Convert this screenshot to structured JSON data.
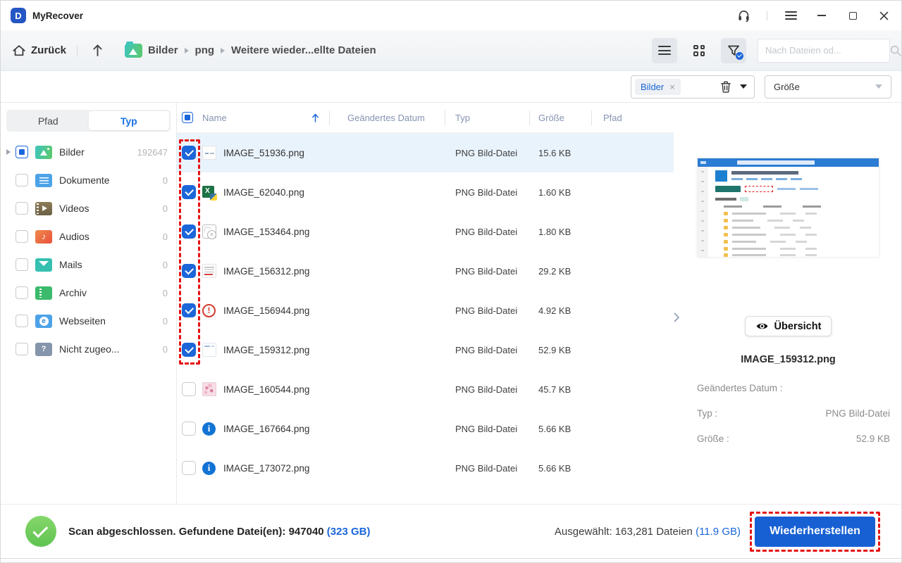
{
  "window": {
    "title": "MyRecover",
    "icons": [
      "headset-icon",
      "menu-icon",
      "minimize-icon",
      "maximize-icon",
      "close-icon"
    ]
  },
  "navbar": {
    "back_label": "Zurück",
    "breadcrumb": [
      "Bilder",
      "png",
      "Weitere wieder...ellte Dateien"
    ],
    "view_icons": [
      "list-view-icon",
      "grid-view-icon",
      "filter-funnel-icon"
    ],
    "search_placeholder": "Nach Dateien od..."
  },
  "filterbar": {
    "type_chip": "Bilder",
    "chip_close_glyph": "×",
    "icons": [
      "trash-icon",
      "caret-down-icon"
    ],
    "size_dropdown_value": "Größe"
  },
  "sidebar": {
    "tabs": [
      {
        "label": "Pfad",
        "active": false
      },
      {
        "label": "Typ",
        "active": true
      }
    ],
    "items": [
      {
        "label": "Bilder",
        "count": "192647",
        "checked": "indeterminate",
        "expandable": true,
        "icon": "images-folder"
      },
      {
        "label": "Dokumente",
        "count": "0",
        "checked": "none",
        "expandable": false,
        "icon": "documents"
      },
      {
        "label": "Videos",
        "count": "0",
        "checked": "none",
        "expandable": false,
        "icon": "videos"
      },
      {
        "label": "Audios",
        "count": "0",
        "checked": "none",
        "expandable": false,
        "icon": "audios"
      },
      {
        "label": "Mails",
        "count": "0",
        "checked": "none",
        "expandable": false,
        "icon": "mails"
      },
      {
        "label": "Archiv",
        "count": "0",
        "checked": "none",
        "expandable": false,
        "icon": "archive"
      },
      {
        "label": "Webseiten",
        "count": "0",
        "checked": "none",
        "expandable": false,
        "icon": "web"
      },
      {
        "label": "Nicht zugeo...",
        "count": "0",
        "checked": "none",
        "expandable": false,
        "icon": "unknown"
      }
    ]
  },
  "table": {
    "columns": [
      "Name",
      "Geändertes Datum",
      "Typ",
      "Größe",
      "Pfad"
    ],
    "sort_icon": "sort-ascending-icon",
    "rows": [
      {
        "name": "IMAGE_51936.png",
        "type": "PNG Bild-Datei",
        "size": "15.6 KB",
        "checked": true,
        "selected": true,
        "icon": "thumb-sketch"
      },
      {
        "name": "IMAGE_62040.png",
        "type": "PNG Bild-Datei",
        "size": "1.60 KB",
        "checked": true,
        "selected": false,
        "icon": "excel-python"
      },
      {
        "name": "IMAGE_153464.png",
        "type": "PNG Bild-Datei",
        "size": "1.80 KB",
        "checked": true,
        "selected": false,
        "icon": "broken-image"
      },
      {
        "name": "IMAGE_156312.png",
        "type": "PNG Bild-Datei",
        "size": "29.2 KB",
        "checked": true,
        "selected": false,
        "icon": "thumb-text"
      },
      {
        "name": "IMAGE_156944.png",
        "type": "PNG Bild-Datei",
        "size": "4.92 KB",
        "checked": true,
        "selected": false,
        "icon": "error"
      },
      {
        "name": "IMAGE_159312.png",
        "type": "PNG Bild-Datei",
        "size": "52.9 KB",
        "checked": true,
        "selected": false,
        "icon": "thumb-faint"
      },
      {
        "name": "IMAGE_160544.png",
        "type": "PNG Bild-Datei",
        "size": "45.7 KB",
        "checked": false,
        "selected": false,
        "icon": "thumb-flower"
      },
      {
        "name": "IMAGE_167664.png",
        "type": "PNG Bild-Datei",
        "size": "5.66 KB",
        "checked": false,
        "selected": false,
        "icon": "info"
      },
      {
        "name": "IMAGE_173072.png",
        "type": "PNG Bild-Datei",
        "size": "5.66 KB",
        "checked": false,
        "selected": false,
        "icon": "info"
      }
    ]
  },
  "preview": {
    "overview_button": "Übersicht",
    "overview_icon": "eye-icon",
    "filename": "IMAGE_159312.png",
    "fields": [
      {
        "label": "Geändertes Datum :",
        "value": ""
      },
      {
        "label": "Typ :",
        "value": "PNG Bild-Datei"
      },
      {
        "label": "Größe :",
        "value": "52.9 KB"
      }
    ]
  },
  "statusbar": {
    "scan_text": "Scan abgeschlossen. Gefundene Datei(en): 947040 ",
    "scan_size": "(323 GB)",
    "selected_text": "Ausgewählt: 163,281 Dateien ",
    "selected_size": "(11.9 GB)",
    "recover_button": "Wiederherstellen"
  },
  "colors": {
    "accent_blue": "#1b66d9",
    "link_blue": "#1a73e8",
    "selected_row": "#e9f3fc",
    "annotation_red": "#e51212",
    "success_green": "#5fc351",
    "header_text": "#8593b2"
  }
}
